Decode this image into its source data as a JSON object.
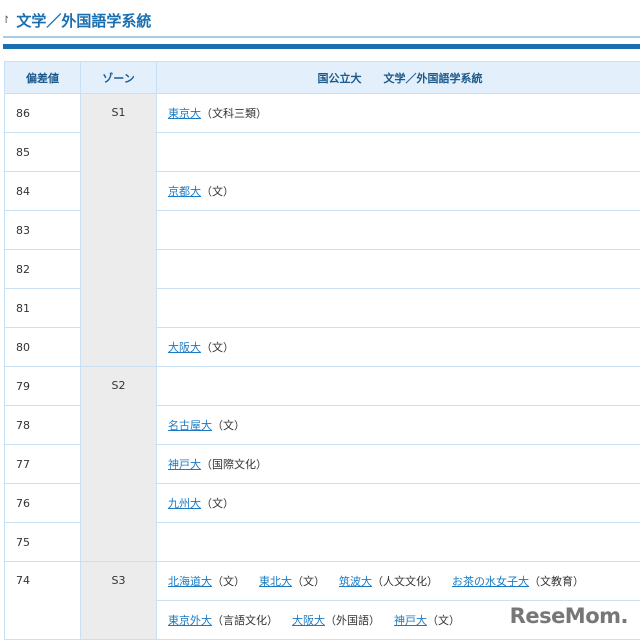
{
  "title": "文学／外国語学系統",
  "headers": {
    "deviation": "偏差値",
    "zone": "ゾーン",
    "unis": "国公立大　　文学／外国語学系統"
  },
  "zones": [
    "S1",
    "S2",
    "S3"
  ],
  "rows": [
    {
      "dev": "86",
      "items": [
        {
          "name": "東京大",
          "dept": "（文科三類）"
        }
      ]
    },
    {
      "dev": "85",
      "items": []
    },
    {
      "dev": "84",
      "items": [
        {
          "name": "京都大",
          "dept": "（文）"
        }
      ]
    },
    {
      "dev": "83",
      "items": []
    },
    {
      "dev": "82",
      "items": []
    },
    {
      "dev": "81",
      "items": []
    },
    {
      "dev": "80",
      "items": [
        {
          "name": "大阪大",
          "dept": "（文）"
        }
      ]
    },
    {
      "dev": "79",
      "items": []
    },
    {
      "dev": "78",
      "items": [
        {
          "name": "名古屋大",
          "dept": "（文）"
        }
      ]
    },
    {
      "dev": "77",
      "items": [
        {
          "name": "神戸大",
          "dept": "（国際文化）"
        }
      ]
    },
    {
      "dev": "76",
      "items": [
        {
          "name": "九州大",
          "dept": "（文）"
        }
      ]
    },
    {
      "dev": "75",
      "items": []
    }
  ],
  "row74": {
    "dev": "74",
    "lines": [
      [
        {
          "name": "北海道大",
          "dept": "（文）"
        },
        {
          "name": "東北大",
          "dept": "（文）"
        },
        {
          "name": "筑波大",
          "dept": "（人文文化）"
        },
        {
          "name": "お茶の水女子大",
          "dept": "（文教育）"
        }
      ],
      [
        {
          "name": "東京外大",
          "dept": "（言語文化）"
        },
        {
          "name": "大阪大",
          "dept": "（外国語）"
        },
        {
          "name": "神戸大",
          "dept": "（文）"
        }
      ]
    ]
  },
  "watermark": "ReseMom"
}
